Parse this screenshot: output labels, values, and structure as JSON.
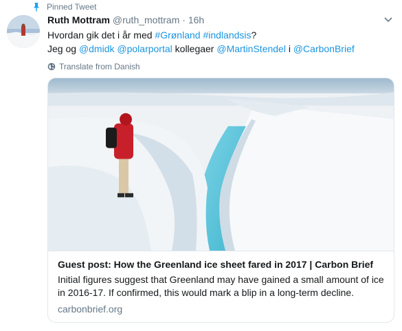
{
  "pinned": {
    "label": "Pinned Tweet",
    "icon": "pin-icon"
  },
  "author": {
    "display_name": "Ruth Mottram",
    "handle": "@ruth_mottram",
    "separator": "·",
    "time": "16h"
  },
  "tweet": {
    "line1": {
      "t1": "Hvordan gik det i år med ",
      "hashtag1": "#Grønland",
      "t2": " ",
      "hashtag2": "#indlandsis",
      "t3": "?"
    },
    "line2": {
      "t1": "Jeg og ",
      "mention1": "@dmidk",
      "t2": " ",
      "mention2": "@polarportal",
      "t3": " kollegaer ",
      "mention3": "@MartinStendel",
      "t4": " i ",
      "mention4": "@CarbonBrief"
    }
  },
  "translate": {
    "label": "Translate from Danish",
    "icon": "globe-icon"
  },
  "card": {
    "title": "Guest post: How the Greenland ice sheet fared in 2017 | Carbon Brief",
    "description": "Initial figures suggest that Greenland may have gained a small amount of ice in 2016-17. If confirmed, this would mark a blip in a long-term decline.",
    "domain": "carbonbrief.org"
  },
  "colors": {
    "link": "#1b95e0",
    "secondary_text": "#657786",
    "border": "#e1e8ed",
    "pin": "#1da1f2"
  }
}
